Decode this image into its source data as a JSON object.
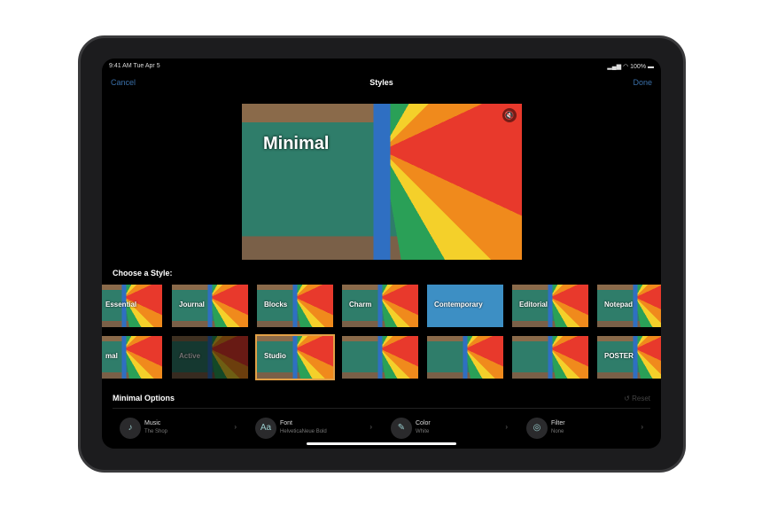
{
  "status": {
    "time": "9:41 AM  Tue Apr 5",
    "battery": "100%"
  },
  "nav": {
    "cancel": "Cancel",
    "title": "Styles",
    "done": "Done"
  },
  "preview": {
    "title": "Minimal"
  },
  "styles": {
    "heading": "Choose a Style:",
    "row1": [
      "Essential",
      "Journal",
      "Blocks",
      "Charm",
      "Contemporary",
      "Editorial",
      "Notepad"
    ],
    "row2": [
      "mal",
      "Active",
      "Studio",
      "",
      "",
      "",
      "POSTER"
    ],
    "selected": "Studio"
  },
  "options": {
    "heading": "Minimal Options",
    "reset": "Reset",
    "items": [
      {
        "label": "Music",
        "value": "The Shop",
        "icon": "music-note-icon"
      },
      {
        "label": "Font",
        "value": "HelveticaNeue Bold",
        "icon": "font-icon"
      },
      {
        "label": "Color",
        "value": "White",
        "icon": "eyedropper-icon"
      },
      {
        "label": "Filter",
        "value": "None",
        "icon": "filter-icon"
      }
    ]
  },
  "colors": {
    "accent": "#3a6fa8",
    "selected": "#e2a046"
  }
}
